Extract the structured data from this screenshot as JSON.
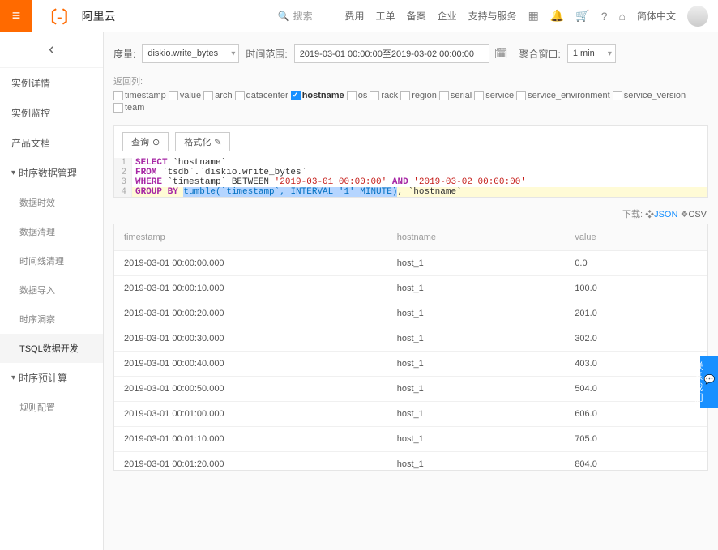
{
  "header": {
    "logo_text": "阿里云",
    "search_placeholder": "搜索",
    "nav": {
      "fee": "费用",
      "ticket": "工单",
      "record": "备案",
      "enterprise": "企业",
      "support": "支持与服务",
      "lang": "简体中文"
    }
  },
  "sidebar": {
    "items": [
      {
        "label": "实例详情",
        "type": "item"
      },
      {
        "label": "实例监控",
        "type": "item"
      },
      {
        "label": "产品文档",
        "type": "item"
      },
      {
        "label": "时序数据管理",
        "type": "group"
      },
      {
        "label": "数据时效",
        "type": "sub"
      },
      {
        "label": "数据清理",
        "type": "sub"
      },
      {
        "label": "时间线清理",
        "type": "sub"
      },
      {
        "label": "数据导入",
        "type": "sub"
      },
      {
        "label": "时序洞察",
        "type": "sub"
      },
      {
        "label": "TSQL数据开发",
        "type": "sub",
        "active": true
      },
      {
        "label": "时序预计算",
        "type": "group"
      },
      {
        "label": "规则配置",
        "type": "sub"
      }
    ]
  },
  "controls": {
    "metric_label": "度量:",
    "metric_value": "diskio.write_bytes",
    "time_label": "时间范围:",
    "time_value": "2019-03-01 00:00:00至2019-03-02 00:00:00",
    "agg_label": "聚合窗口:",
    "agg_value": "1 min"
  },
  "columns": {
    "label": "返回列:",
    "items": [
      {
        "name": "timestamp",
        "checked": false
      },
      {
        "name": "value",
        "checked": false
      },
      {
        "name": "arch",
        "checked": false
      },
      {
        "name": "datacenter",
        "checked": false
      },
      {
        "name": "hostname",
        "checked": true
      },
      {
        "name": "os",
        "checked": false
      },
      {
        "name": "rack",
        "checked": false
      },
      {
        "name": "region",
        "checked": false
      },
      {
        "name": "serial",
        "checked": false
      },
      {
        "name": "service",
        "checked": false
      },
      {
        "name": "service_environment",
        "checked": false
      },
      {
        "name": "service_version",
        "checked": false
      },
      {
        "name": "team",
        "checked": false
      }
    ]
  },
  "toolbar": {
    "query_label": "查询",
    "format_label": "格式化"
  },
  "editor": {
    "lines": [
      {
        "n": "1"
      },
      {
        "n": "2"
      },
      {
        "n": "3"
      },
      {
        "n": "4"
      }
    ],
    "select_kw": "SELECT",
    "hostname_col": " `hostname`",
    "from_kw": "FROM",
    "from_rest": " `tsdb`.`diskio.write_bytes`",
    "where_kw": "WHERE",
    "where_mid": " `timestamp` BETWEEN ",
    "str1": "'2019-03-01 00:00:00'",
    "and_kw": " AND ",
    "str2": "'2019-03-02 00:00:00'",
    "group_kw": "GROUP BY ",
    "tumble_fn": "tumble(`timestamp`, INTERVAL '1' MINUTE)",
    "group_rest": ", `hostname`"
  },
  "download": {
    "label": "下载:",
    "json": "JSON",
    "csv": "CSV"
  },
  "table": {
    "headers": {
      "ts": "timestamp",
      "host": "hostname",
      "val": "value"
    },
    "rows": [
      {
        "ts": "2019-03-01 00:00:00.000",
        "host": "host_1",
        "val": "0.0"
      },
      {
        "ts": "2019-03-01 00:00:10.000",
        "host": "host_1",
        "val": "100.0"
      },
      {
        "ts": "2019-03-01 00:00:20.000",
        "host": "host_1",
        "val": "201.0"
      },
      {
        "ts": "2019-03-01 00:00:30.000",
        "host": "host_1",
        "val": "302.0"
      },
      {
        "ts": "2019-03-01 00:00:40.000",
        "host": "host_1",
        "val": "403.0"
      },
      {
        "ts": "2019-03-01 00:00:50.000",
        "host": "host_1",
        "val": "504.0"
      },
      {
        "ts": "2019-03-01 00:01:00.000",
        "host": "host_1",
        "val": "606.0"
      },
      {
        "ts": "2019-03-01 00:01:10.000",
        "host": "host_1",
        "val": "705.0"
      },
      {
        "ts": "2019-03-01 00:01:20.000",
        "host": "host_1",
        "val": "804.0"
      }
    ]
  },
  "contact": {
    "label": "联系我们"
  }
}
